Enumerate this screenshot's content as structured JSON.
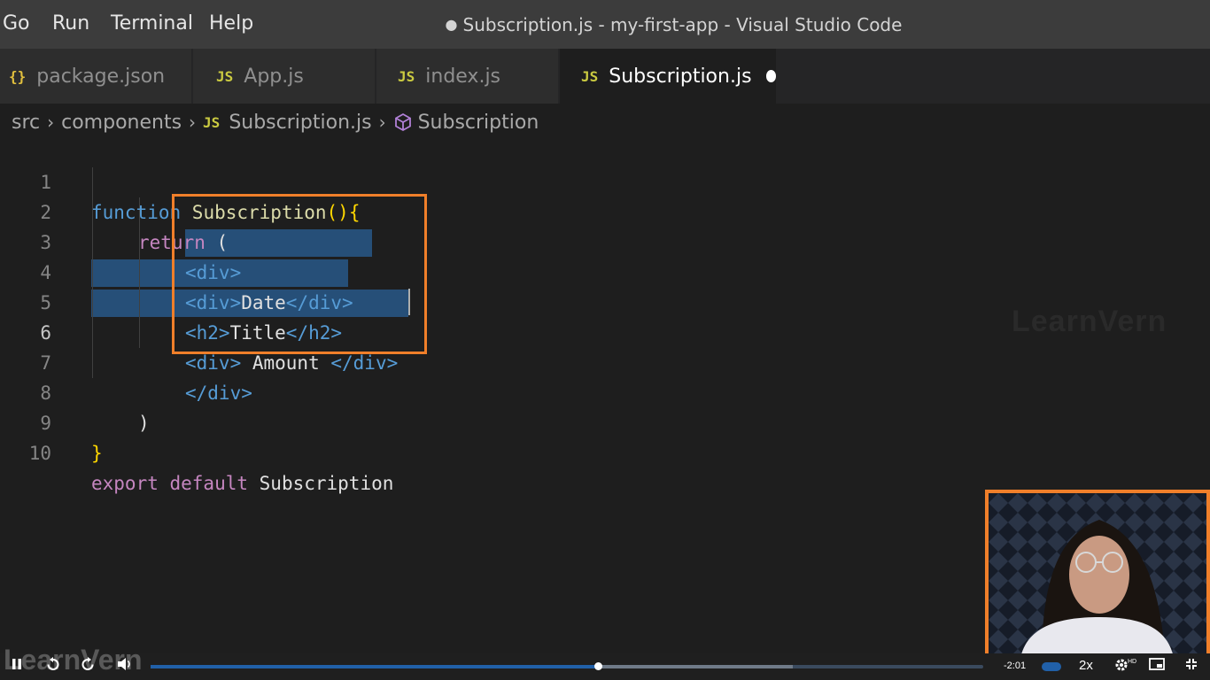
{
  "menu": {
    "go": "Go",
    "run": "Run",
    "terminal": "Terminal",
    "help": "Help"
  },
  "window_title": "Subscription.js - my-first-app - Visual Studio Code",
  "window_title_dot": "●",
  "tabs": [
    {
      "icon": "{}",
      "label": "package.json"
    },
    {
      "icon": "JS",
      "label": "App.js"
    },
    {
      "icon": "JS",
      "label": "index.js"
    },
    {
      "icon": "JS",
      "label": "Subscription.js",
      "active": true,
      "dirty": true
    }
  ],
  "breadcrumb": {
    "src": "src",
    "components": "components",
    "file_icon": "JS",
    "file": "Subscription.js",
    "symbol": "Subscription"
  },
  "editor": {
    "active_line": 6,
    "line_numbers": [
      "1",
      "2",
      "3",
      "4",
      "5",
      "6",
      "7",
      "8",
      "9",
      "10"
    ],
    "code": {
      "l1_kw": "function",
      "l1_name": " Subscription",
      "l1_paren": "()",
      "l1_brace": "{",
      "l2_kw": "return",
      "l2_paren": " (",
      "l3": "<div>",
      "l4_open": "<div>",
      "l4_text": "Date",
      "l4_close": "</div>",
      "l5_open": "<h2>",
      "l5_text": "Title",
      "l5_close": "</h2>",
      "l6_open": "<div>",
      "l6_text": " Amount ",
      "l6_close": "</div>",
      "l7": "</div>",
      "l8": ")",
      "l9": "}",
      "l10_kw1": "export",
      "l10_kw2": " default",
      "l10_name": " Subscription"
    }
  },
  "watermark": "LearnVern",
  "player": {
    "logo": "LearnVern",
    "time_remaining": "-2:01",
    "speed": "2x",
    "hd_badge": "HD",
    "progress": 0.537,
    "buffered": 0.771
  },
  "colors": {
    "accent_orange": "#f07f2a",
    "selection": "#264f78",
    "progress": "#2160a8"
  }
}
